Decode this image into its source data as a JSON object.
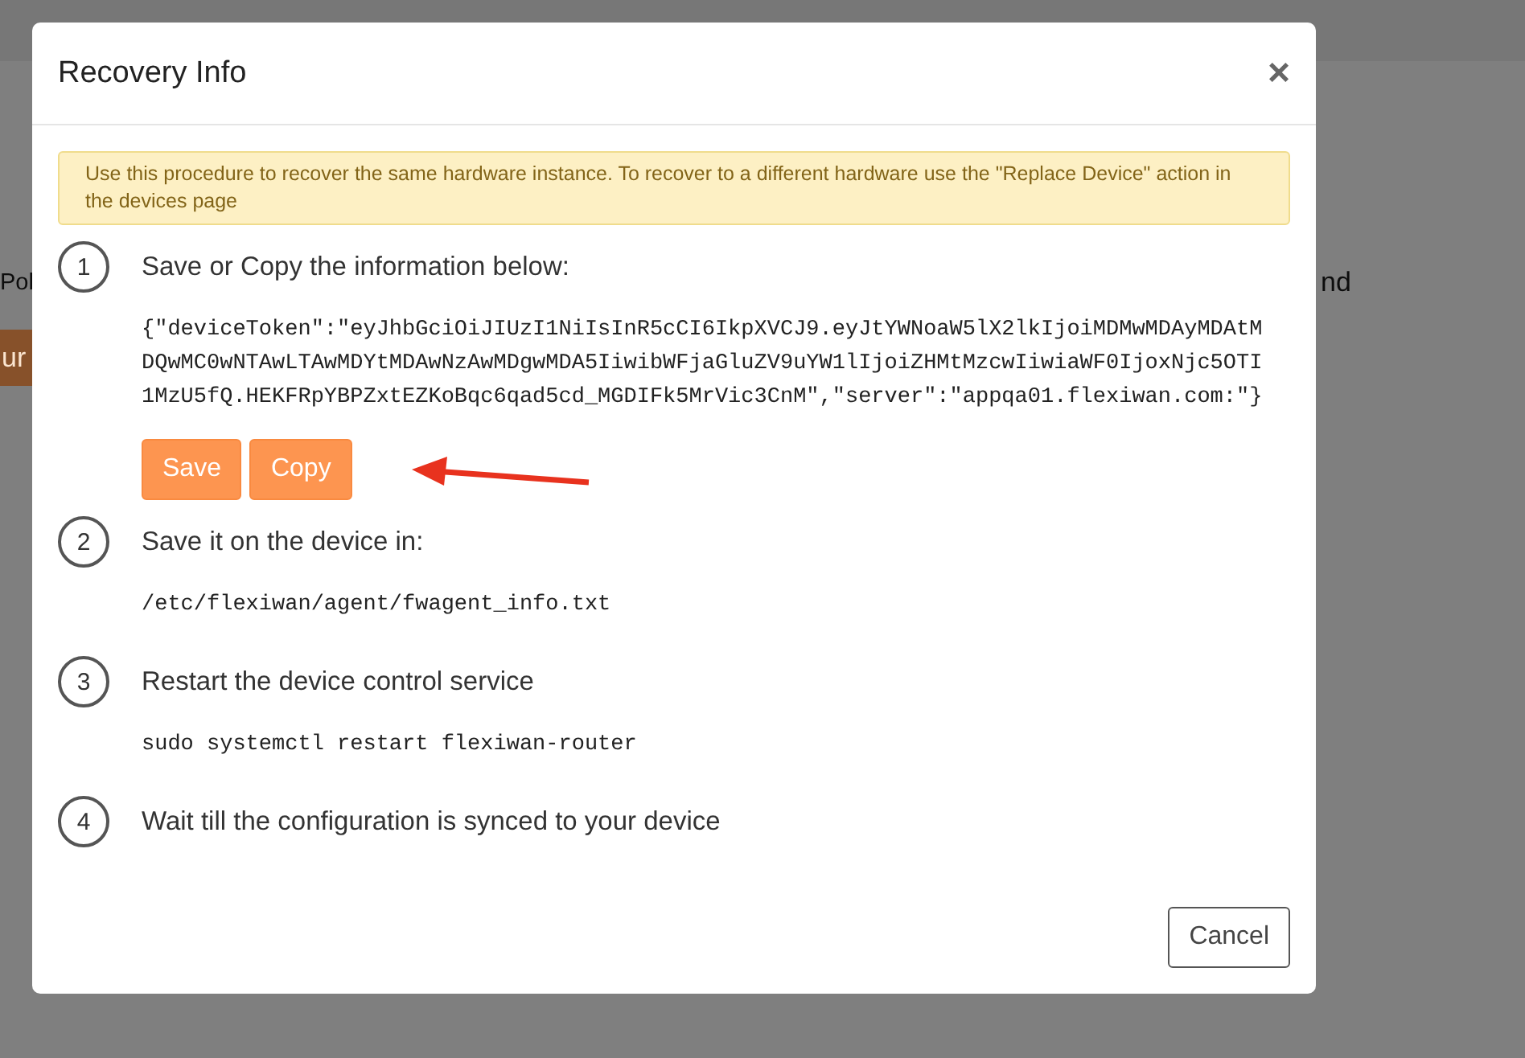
{
  "background": {
    "column_1": "Pol",
    "column_2": "nd",
    "button": "ur"
  },
  "modal": {
    "title": "Recovery Info",
    "close": "×",
    "alert": "Use this procedure to recover the same hardware instance. To recover to a different hardware use the \"Replace Device\" action in the devices page",
    "steps": [
      {
        "number": "1",
        "kind": "save",
        "text": "Save or Copy the information below:",
        "code": "{\"deviceToken\":\"eyJhbGciOiJIUzI1NiIsInR5cCI6IkpXVCJ9.eyJtYWNoaW5lX2lkIjoiMDMwMDAyMDAtMDQwMC0wNTAwLTAwMDYtMDAwNzAwMDgwMDA5IiwibWFjaGluZV9uYW1lIjoiZHMtMzcwIiwiaWF0IjoxNjc5OTI1MzU5fQ.HEKFRpYBPZxtEZKoBqc6qad5cd_MGDIFk5MrVic3CnM\",\"server\":\"appqa01.flexiwan.com:\"}",
        "buttons": [
          "Save",
          "Copy"
        ]
      },
      {
        "number": "2",
        "kind": "code",
        "text": "Save it on the device in:",
        "code": "/etc/flexiwan/agent/fwagent_info.txt"
      },
      {
        "number": "3",
        "kind": "code",
        "text": "Restart the device control service",
        "code": "sudo systemctl restart flexiwan-router"
      },
      {
        "number": "4",
        "kind": "plain",
        "text": "Wait till the configuration is synced to your device"
      }
    ],
    "footer_button": "Cancel"
  }
}
